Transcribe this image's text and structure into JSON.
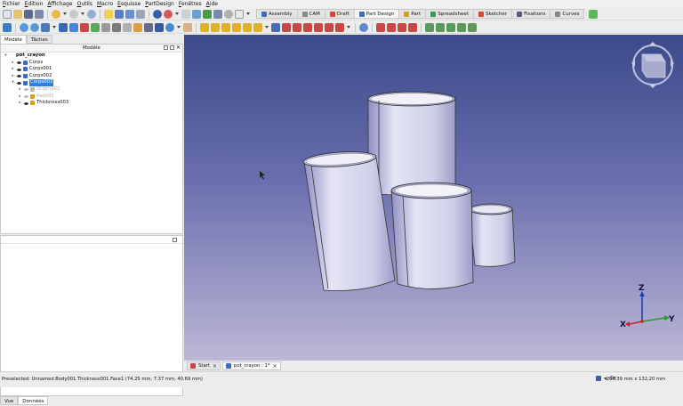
{
  "menu": [
    "Fichier",
    "Edition",
    "Affichage",
    "Outils",
    "Macro",
    "Esquisse",
    "PartDesign",
    "Fenêtres",
    "Aide"
  ],
  "workbenches": [
    {
      "label": "Assembly",
      "color": "#3d6fb8"
    },
    {
      "label": "CAM",
      "color": "#8a8a8a"
    },
    {
      "label": "Draft",
      "color": "#d04a3a"
    },
    {
      "label": "Part Design",
      "color": "#3b6bc4",
      "active": true
    },
    {
      "label": "Part",
      "color": "#c9a227"
    },
    {
      "label": "Spreadsheet",
      "color": "#3a9a4a"
    },
    {
      "label": "Sketcher",
      "color": "#d44a3a"
    },
    {
      "label": "Fixations",
      "color": "#555a8a"
    },
    {
      "label": "Curves",
      "color": "#888"
    }
  ],
  "left_panel": {
    "tabs": [
      "Modèle",
      "Tâches"
    ],
    "tree_header": "Modèle",
    "tree": [
      {
        "label": "pot_crayon",
        "level": 0,
        "expanded": true,
        "bold": true
      },
      {
        "label": "Corps",
        "level": 1,
        "icon_color": "#3b6bc4"
      },
      {
        "label": "Corps001",
        "level": 1,
        "icon_color": "#3b6bc4"
      },
      {
        "label": "Corps002",
        "level": 1,
        "icon_color": "#3b6bc4"
      },
      {
        "label": "Corps003",
        "level": 1,
        "icon_color": "#3b6bc4",
        "selected": true,
        "expanded": true
      },
      {
        "label": "Origin003",
        "level": 2,
        "dim": true,
        "icon_color": "#b8b8b8"
      },
      {
        "label": "Pad003",
        "level": 2,
        "dim": true,
        "icon_color": "#c9a227"
      },
      {
        "label": "Thickness003",
        "level": 2,
        "icon_color": "#c9a227"
      }
    ],
    "bottom_tabs": [
      "Vue",
      "Données"
    ]
  },
  "doc_tabs": [
    "Start",
    "pot_crayon : 1*"
  ],
  "status": {
    "message": "Preselected: Unnamed.Body001.Thickness001.Face1 (74.25 mm, 7.37 mm, 40.69 mm)",
    "dimensions": "203,39 mm x 132,20 mm",
    "nav_label": "Ge"
  },
  "axis": {
    "x": "X",
    "y": "Y",
    "z": "Z",
    "x_color": "#d02020",
    "y_color": "#20a020",
    "z_color": "#2040c0"
  },
  "colors": {
    "accent": "#2d7fe0",
    "viewport_top": "#3b4a8a",
    "viewport_bottom": "#bdb7d6"
  }
}
